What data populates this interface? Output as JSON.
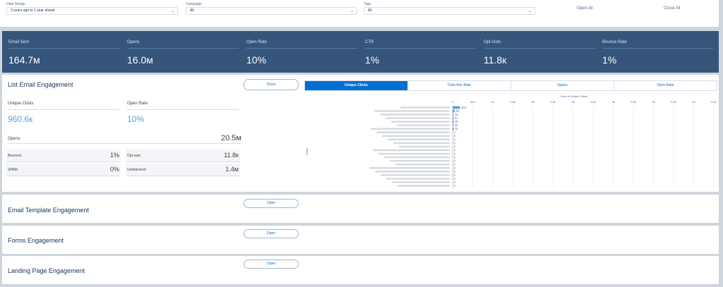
{
  "filters": {
    "date_range": {
      "label": "Date Range",
      "value": "2 years ago to 1 year ahead"
    },
    "campaign": {
      "label": "Campaign",
      "value": "All"
    },
    "tags": {
      "label": "Tags",
      "value": "All"
    },
    "open_all": "Open All",
    "close_all": "Close All"
  },
  "kpis": [
    {
      "label": "Email Sent",
      "value": "164.7м"
    },
    {
      "label": "Opens",
      "value": "16.0м"
    },
    {
      "label": "Open Rate",
      "value": "10%"
    },
    {
      "label": "CTR",
      "value": "1%"
    },
    {
      "label": "Opt-Outs",
      "value": "11.8к"
    },
    {
      "label": "Bounce Rate",
      "value": "1%"
    }
  ],
  "list_email": {
    "title": "List Email Engagement",
    "toggle": "Close",
    "tabs": [
      "Unique Clicks",
      "Click-thru Rate",
      "Opens",
      "Open Rate"
    ],
    "unique_clicks": {
      "label": "Unique Clicks",
      "value": "960.6к"
    },
    "open_rate": {
      "label": "Open Rate",
      "value": "10%"
    },
    "opens": {
      "label": "Opens",
      "value": "20.5м"
    },
    "bounces": {
      "label": "Bounces",
      "value": "1%"
    },
    "optouts": {
      "label": "Opt-outs",
      "value": "11.8к"
    },
    "spam": {
      "label": "SPAM",
      "value": "0%"
    },
    "undelivered": {
      "label": "Undelivered",
      "value": "1.4м"
    }
  },
  "collapsed_panels": [
    {
      "title": "Email Template Engagement",
      "toggle": "Open"
    },
    {
      "title": "Forms Engagement",
      "toggle": "Open"
    },
    {
      "title": "Landing Page Engagement",
      "toggle": "Open"
    }
  ],
  "chart_data": {
    "type": "bar",
    "orientation": "horizontal",
    "title": "Sum of Unique Clicks",
    "ylabel": "Name",
    "xticks": [
      "0",
      "500",
      "1k",
      "1.5k",
      "2k",
      "2.5k",
      "3k",
      "3.5k",
      "4k",
      "4.5k",
      "5k",
      "5.5k",
      "6k",
      "6.5k"
    ],
    "xlim": [
      0,
      6500
    ],
    "values": [
      184,
      49,
      16,
      27,
      28,
      10,
      31,
      0,
      0,
      0,
      0,
      0,
      0,
      0,
      0,
      0,
      0,
      0,
      0,
      0,
      0,
      0,
      0
    ],
    "value_labels": [
      "184",
      "49",
      "16",
      "27",
      "28",
      "10",
      "31",
      "0",
      "0",
      "0",
      "0",
      "0",
      "0",
      "0",
      "0",
      "0",
      "0",
      "0",
      "0",
      "0",
      "0",
      "0",
      "0"
    ],
    "bar_color": "#5aa0d8",
    "grid": true
  }
}
